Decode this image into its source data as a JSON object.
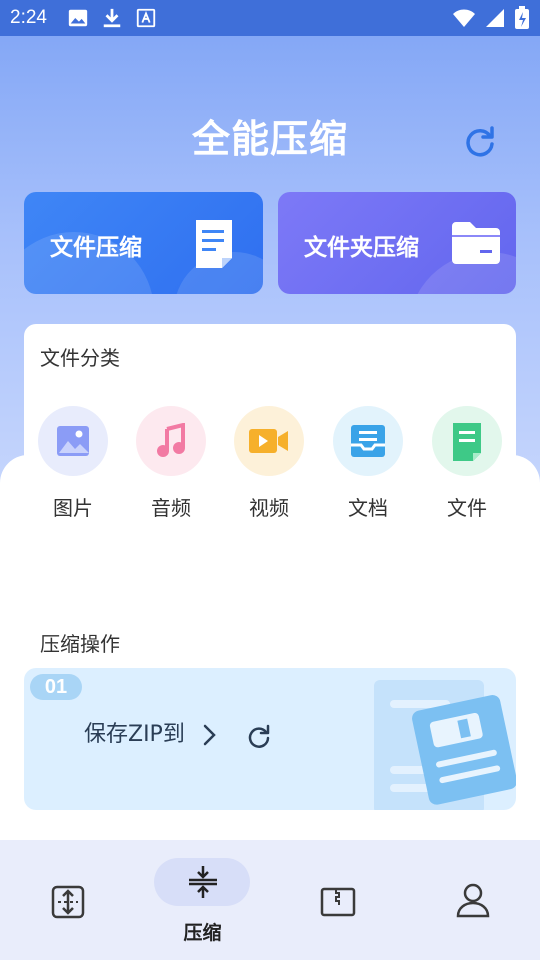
{
  "status_bar": {
    "time": "2:24",
    "left_icons": [
      "image-icon",
      "download-icon",
      "a-box-icon"
    ],
    "right_icons": [
      "wifi-icon",
      "signal-icon",
      "battery-icon"
    ]
  },
  "header": {
    "title": "全能压缩",
    "refresh_icon": "refresh-icon"
  },
  "quick_actions": [
    {
      "label": "文件压缩",
      "icon": "document-icon",
      "color": "#3b7ff5"
    },
    {
      "label": "文件夹压缩",
      "icon": "folder-icon",
      "color": "#6e6ff3"
    }
  ],
  "categories": {
    "title": "文件分类",
    "items": [
      {
        "label": "图片",
        "icon": "image-icon",
        "bg": "#e8ecfc"
      },
      {
        "label": "音频",
        "icon": "music-note-icon",
        "bg": "#fde9ef"
      },
      {
        "label": "视频",
        "icon": "video-icon",
        "bg": "#fdf1d9"
      },
      {
        "label": "文档",
        "icon": "inbox-tray-icon",
        "bg": "#e2f3fc"
      },
      {
        "label": "文件",
        "icon": "file-icon",
        "bg": "#e2f7ec"
      }
    ]
  },
  "operations": {
    "title": "压缩操作",
    "badge": "01",
    "save_label": "保存ZIP到",
    "chevron_icon": "chevron-right-icon",
    "refresh_icon": "refresh-icon"
  },
  "bottom_nav": [
    {
      "label": "",
      "icon": "transfer-icon",
      "active": false
    },
    {
      "label": "压缩",
      "icon": "compress-icon",
      "active": true
    },
    {
      "label": "",
      "icon": "archive-icon",
      "active": false
    },
    {
      "label": "",
      "icon": "person-icon",
      "active": false
    }
  ],
  "colors": {
    "status_bar": "#3f6fd9",
    "accent": "#2f6ff0",
    "nav_bg": "#e9edfb"
  }
}
